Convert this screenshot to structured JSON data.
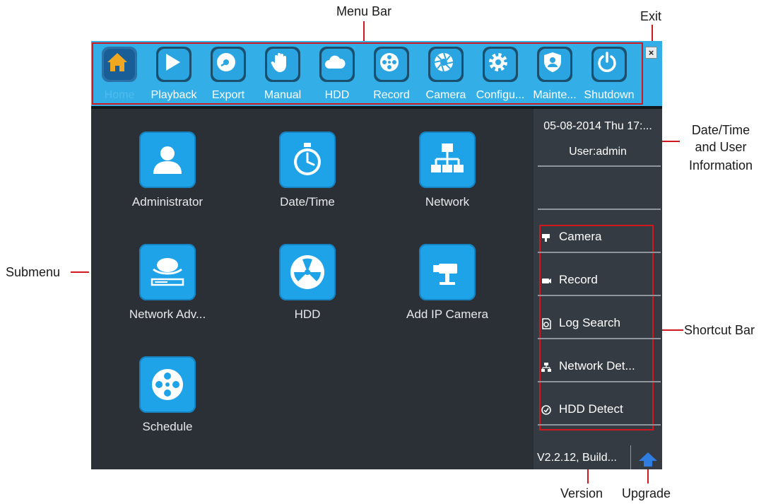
{
  "annotations": {
    "menu_bar": "Menu Bar",
    "exit": "Exit",
    "date_time_user": [
      "Date/Time",
      "and User",
      "Information"
    ],
    "submenu": "Submenu",
    "shortcut_bar": "Shortcut Bar",
    "version": "Version",
    "upgrade": "Upgrade"
  },
  "menu": {
    "items": [
      {
        "label": "Home",
        "icon": "home-icon"
      },
      {
        "label": "Playback",
        "icon": "play-icon"
      },
      {
        "label": "Export",
        "icon": "disc-icon"
      },
      {
        "label": "Manual",
        "icon": "hand-icon"
      },
      {
        "label": "HDD",
        "icon": "cloud-icon"
      },
      {
        "label": "Record",
        "icon": "film-reel-icon"
      },
      {
        "label": "Camera",
        "icon": "aperture-icon"
      },
      {
        "label": "Configu...",
        "icon": "gear-icon"
      },
      {
        "label": "Mainte...",
        "icon": "shield-user-icon"
      },
      {
        "label": "Shutdown",
        "icon": "power-icon"
      }
    ],
    "active_index": 0,
    "exit_symbol": "×"
  },
  "submenu": {
    "items": [
      {
        "label": "Administrator",
        "icon": "user-icon"
      },
      {
        "label": "Date/Time",
        "icon": "stopwatch-icon"
      },
      {
        "label": "Network",
        "icon": "network-icon"
      },
      {
        "label": "Network Adv...",
        "icon": "network-device-icon"
      },
      {
        "label": "HDD",
        "icon": "hdd-icon"
      },
      {
        "label": "Add IP Camera",
        "icon": "ip-camera-icon"
      },
      {
        "label": "Schedule",
        "icon": "reel-icon"
      }
    ]
  },
  "status": {
    "datetime": "05-08-2014 Thu 17:...",
    "user": "User:admin"
  },
  "shortcuts": [
    {
      "label": "Camera",
      "icon": "camera-icon"
    },
    {
      "label": "Record",
      "icon": "record-icon"
    },
    {
      "label": "Log Search",
      "icon": "log-search-icon"
    },
    {
      "label": "Network Det...",
      "icon": "network-detect-icon"
    },
    {
      "label": "HDD Detect",
      "icon": "hdd-detect-icon"
    }
  ],
  "footer": {
    "version": "V2.2.12, Build...",
    "upgrade_icon": "upgrade-arrow-icon"
  },
  "colors": {
    "menubar": "#33aee6",
    "background": "#2b3036",
    "panel": "#353b43",
    "icon_tile": "#1fa3e8",
    "active_label": "#4fbcef",
    "callout_line": "#d0191f",
    "upgrade": "#2f7de0"
  }
}
